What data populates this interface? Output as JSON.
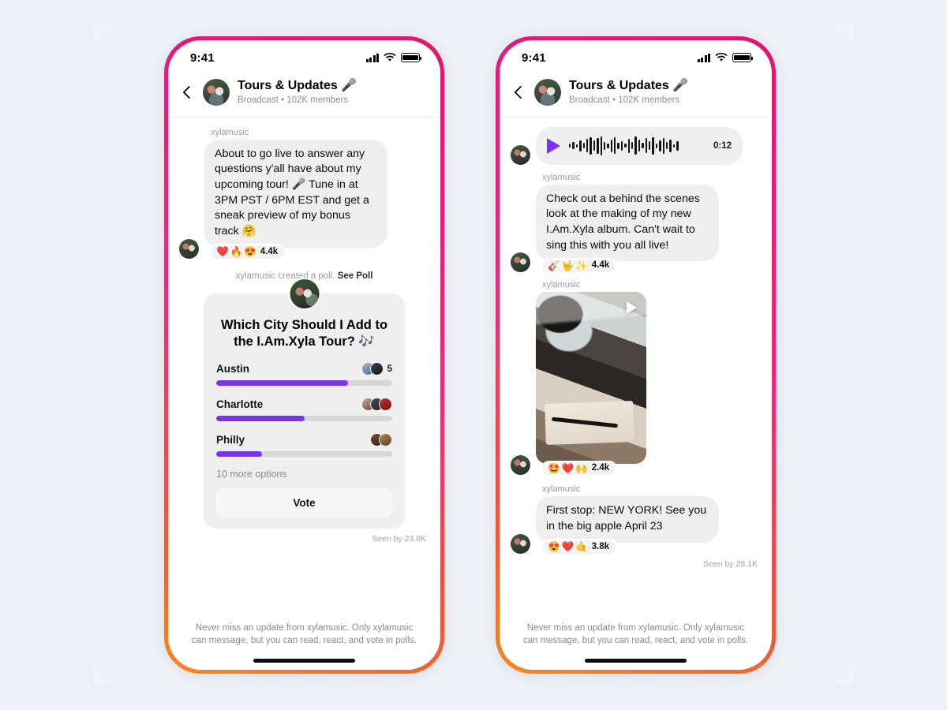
{
  "theme": {
    "page_background": "#edf0f5",
    "frame_gradient_start": "#e0166f",
    "frame_gradient_end": "#f6891f",
    "poll_bar_color": "#7b35e8",
    "bubble_background": "#efefef"
  },
  "status_bar": {
    "time": "9:41",
    "signal_icon": "cellular-signal-icon",
    "wifi_icon": "wifi-icon",
    "battery_icon": "battery-full-icon"
  },
  "header": {
    "back_icon": "back-chevron-icon",
    "avatar": "channel-avatar",
    "title": "Tours & Updates 🎤",
    "subtitle": "Broadcast • 102K members"
  },
  "left_phone": {
    "handle": "xylamusic",
    "message": "About to go live to answer any questions y'all have about my upcoming tour! 🎤 Tune in at 3PM PST / 6PM EST and get a sneak preview of my bonus track 🤗",
    "reactions": {
      "emojis": [
        "❤️",
        "🔥",
        "😍"
      ],
      "count": "4.4k"
    },
    "poll_notice_text": "xylamusic created a poll.",
    "poll_notice_link": "See Poll",
    "poll": {
      "question": "Which City Should I Add to the I.Am.Xyla Tour? 🎶",
      "options": [
        {
          "label": "Austin",
          "percent": 75,
          "voter_count": "5",
          "avatars": [
            "voter-avatar-1",
            "voter-avatar-2"
          ]
        },
        {
          "label": "Charlotte",
          "percent": 50,
          "voter_count": "",
          "avatars": [
            "voter-avatar-3",
            "voter-avatar-4",
            "voter-avatar-5"
          ]
        },
        {
          "label": "Philly",
          "percent": 26,
          "voter_count": "",
          "avatars": [
            "voter-avatar-6",
            "voter-avatar-7"
          ]
        }
      ],
      "more_options": "10 more options",
      "vote_button": "Vote"
    },
    "seen_by": "Seen by 23.8K",
    "footer": "Never miss an update from xylamusic. Only xylamusic can message, but you can read, react, and vote in polls."
  },
  "right_phone": {
    "voice_note": {
      "play_icon": "play-icon",
      "duration": "0:12",
      "waveform_label": "audio-waveform"
    },
    "message_1": {
      "handle": "xylamusic",
      "text": "Check out a behind the scenes look at the making of my new I.Am.Xyla album. Can't wait to sing this with you all live!",
      "reactions": {
        "emojis": [
          "🎸",
          "🤟",
          "✨"
        ],
        "count": "4.4k"
      }
    },
    "video_post": {
      "handle": "xylamusic",
      "play_icon": "play-icon",
      "reactions": {
        "emojis": [
          "🤩",
          "❤️",
          "🙌"
        ],
        "count": "2.4k"
      }
    },
    "message_2": {
      "handle": "xylamusic",
      "text": "First stop: NEW YORK! See you in the big apple April 23",
      "reactions": {
        "emojis": [
          "😍",
          "❤️",
          "🤙"
        ],
        "count": "3.8k"
      }
    },
    "seen_by": "Seen by 28.1K",
    "footer": "Never miss an update from xylamusic. Only xylamusic can message, but you can read, react, and vote in polls."
  }
}
